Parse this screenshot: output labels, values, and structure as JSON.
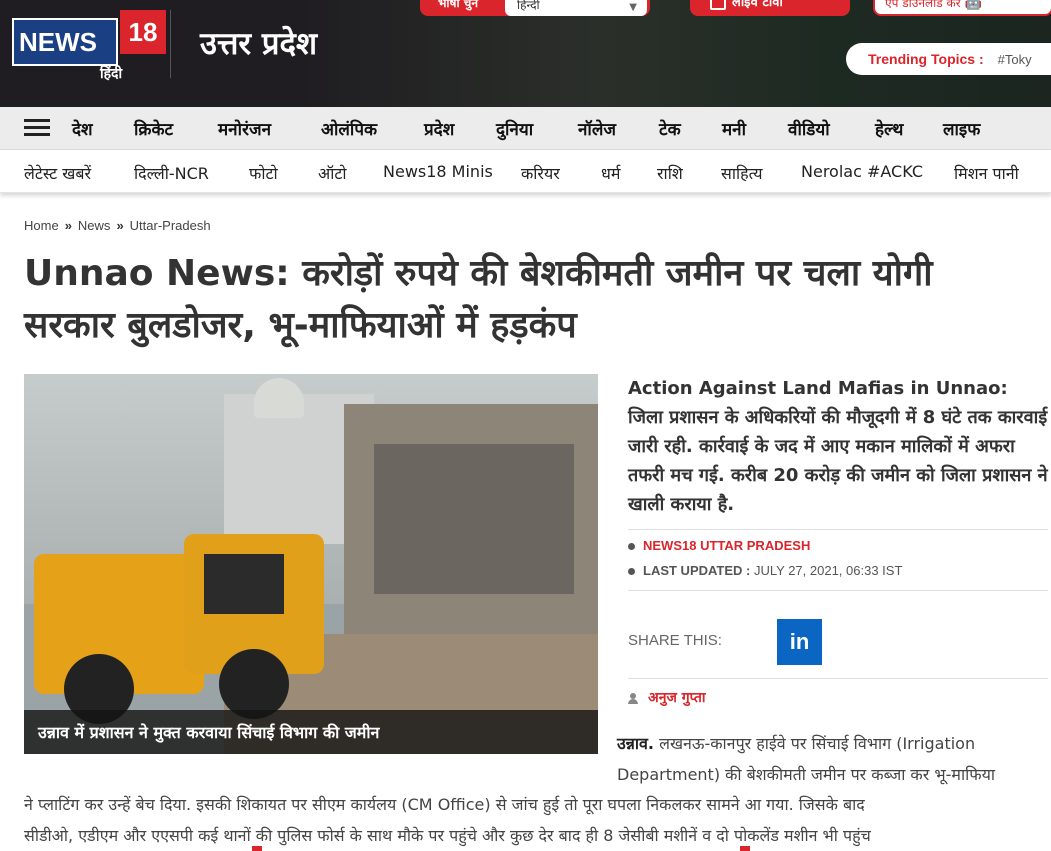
{
  "header": {
    "logo_text": "NEWS",
    "logo_number": "18",
    "logo_sub": "हिंदी",
    "state_title": "उत्तर प्रदेश",
    "lang_label": "भाषा चुने",
    "lang_selected": "हिन्दी",
    "live_tv": "लाइव टीवी",
    "app_download": "एप डाउनलोड कर",
    "trending_label": "Trending Topics :",
    "trending_tag": "#Toky"
  },
  "nav_primary": [
    "देश",
    "क्रिकेट",
    "मनोरंजन",
    "ओलंपिक",
    "प्रदेश",
    "दुनिया",
    "नॉलेज",
    "टेक",
    "मनी",
    "वीडियो",
    "हेल्थ",
    "लाइफ"
  ],
  "nav_secondary": [
    "लेटेस्ट खबरें",
    "दिल्ली-NCR",
    "फोटो",
    "ऑटो",
    "News18 Minis",
    "करियर",
    "धर्म",
    "राशि",
    "साहित्य",
    "Nerolac #ACKC",
    "मिशन पानी"
  ],
  "breadcrumb": [
    "Home",
    "News",
    "Uttar-Pradesh"
  ],
  "article": {
    "headline": "Unnao News: करोड़ों रुपये की बेशकीमती जमीन पर चला योगी सरकार बुलडोजर, भू-माफियाओं में हड़कंप",
    "image_caption": "उन्नाव में प्रशासन ने मुक्त करवाया सिंचाई विभाग की जमीन",
    "summary": "Action Against Land Mafias in Unnao: जिला प्रशासन के अधिकरियों की मौजूदगी में 8 घंटे तक कारवाई जारी रही. कार्रवाई के जद में आए मकान मालिकों में अफरा तफरी मच गई. करीब 20 करोड़ की जमीन को जिला प्रशासन ने खाली कराया है.",
    "source": "NEWS18 UTTAR PRADESH",
    "updated_label": "LAST UPDATED :",
    "updated_value": "JULY 27, 2021, 06:33 IST",
    "share_label": "SHARE THIS:",
    "linkedin": "in",
    "author": "अनुज गुप्ता",
    "dateline": "उन्नाव.",
    "body_p1": " लखनऊ-कानपुर हाईवे पर सिंचाई विभाग (Irrigation Department) की बेशकीमती जमीन पर कब्जा कर भू-माफिया",
    "body_l2": "ने प्लाटिंग कर उन्हें बेच दिया. इसकी शिकायत पर सीएम कार्यलय (CM Office) से जांच हुई तो पूरा घपला निकलकर सामने आ गया. जिसके बाद",
    "body_l3": "सीडीओ, एडीएम और एएसपी कई थानों की पुलिस फोर्स के साथ मौके पर पहुंचे और कुछ देर बाद ही 8 जेसीबी मशीनें व दो पोकलेंड मशीन भी पहुंच"
  }
}
